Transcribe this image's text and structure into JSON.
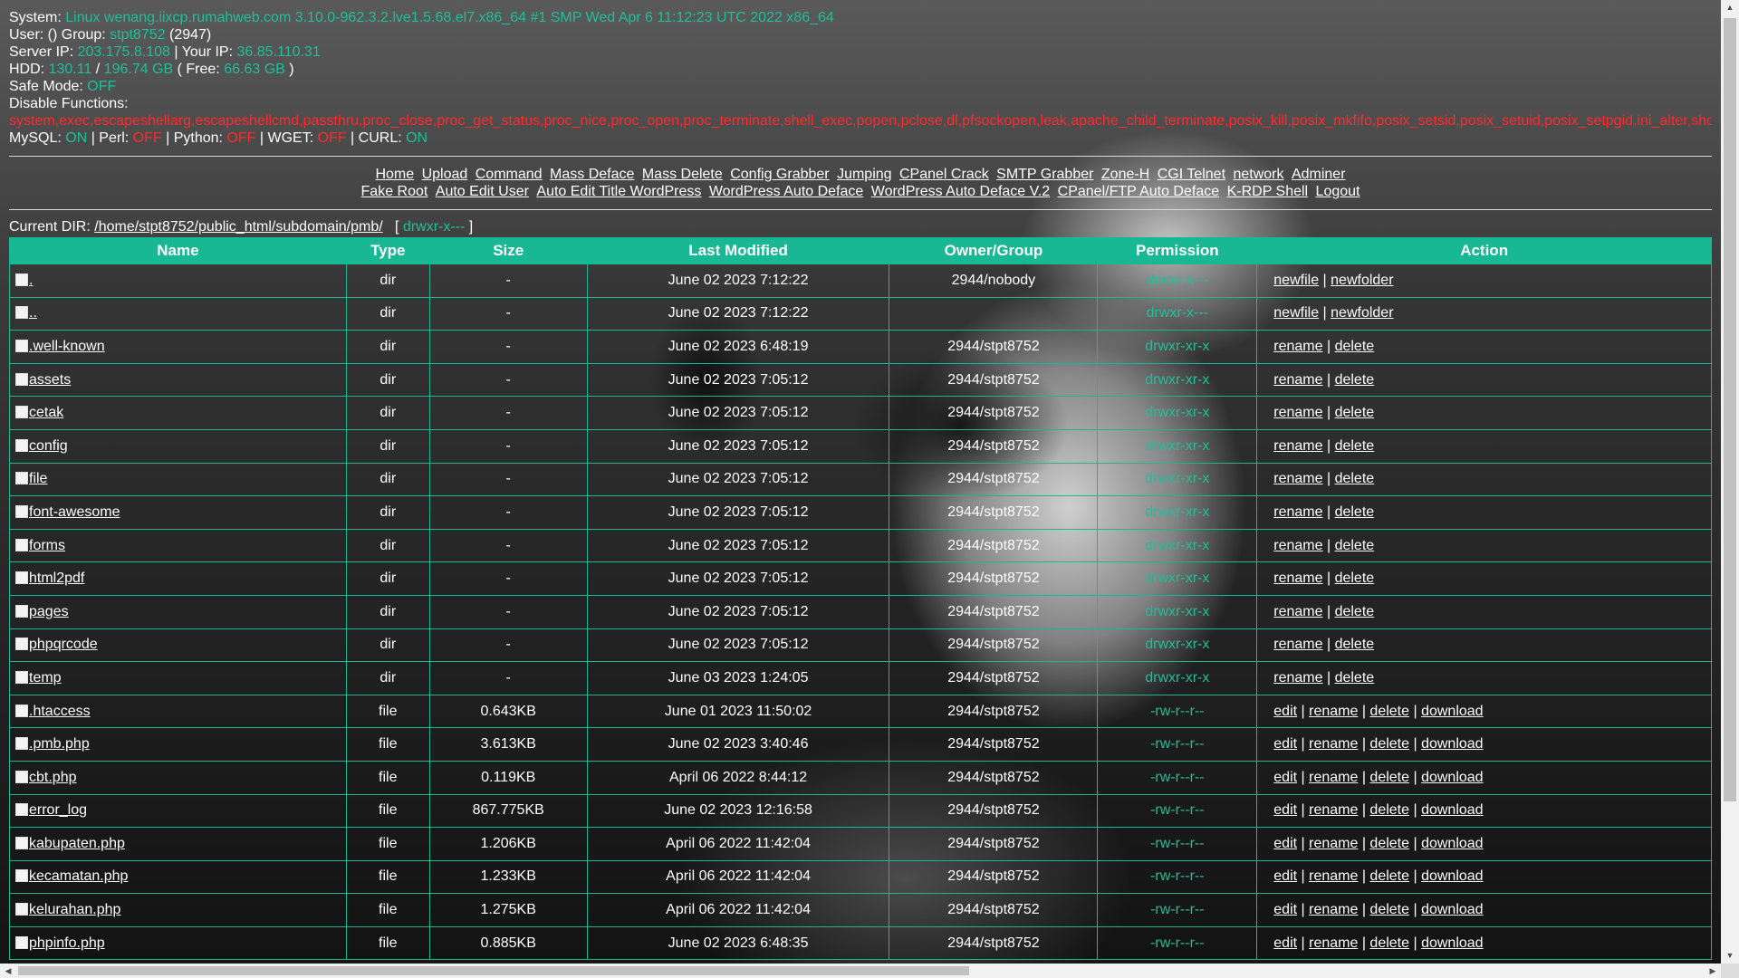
{
  "sysinfo": {
    "system_label": "System:",
    "system_value": "Linux wenang.iixcp.rumahweb.com 3.10.0-962.3.2.lve1.5.68.el7.x86_64 #1 SMP Wed Apr 6 11:12:23 UTC 2022 x86_64",
    "user_label": "User: () Group:",
    "group_value": "stpt8752",
    "group_id": "(2947)",
    "server_ip_label": "Server IP:",
    "server_ip": "203.175.8.108",
    "your_ip_label": "| Your IP:",
    "your_ip": "36.85.110.31",
    "hdd_label": "HDD:",
    "hdd_used": "130.11",
    "hdd_sep": "/",
    "hdd_total": "196.74 GB",
    "hdd_free_label": "( Free:",
    "hdd_free": "66.63 GB",
    "hdd_close": ")",
    "safe_mode_label": "Safe Mode:",
    "safe_mode": "OFF",
    "disable_label": "Disable Functions:",
    "disable_list": "system,exec,escapeshellarg,escapeshellcmd,passthru,proc_close,proc_get_status,proc_nice,proc_open,proc_terminate,shell_exec,popen,pclose,dl,pfsockopen,leak,apache_child_terminate,posix_kill,posix_mkfifo,posix_setsid,posix_setuid,posix_setpgid,ini_alter,show_source",
    "mysql_label": "MySQL:",
    "mysql": "ON",
    "perl_label": "| Perl:",
    "perl": "OFF",
    "python_label": "| Python:",
    "python": "OFF",
    "wget_label": "| WGET:",
    "wget": "OFF",
    "curl_label": "| CURL:",
    "curl": "ON"
  },
  "menu": {
    "row1": [
      "Home",
      "Upload",
      "Command",
      "Mass Deface",
      "Mass Delete",
      "Config Grabber",
      "Jumping",
      "CPanel Crack",
      "SMTP Grabber",
      "Zone-H",
      "CGI Telnet",
      "network",
      "Adminer"
    ],
    "row2": [
      "Fake Root",
      "Auto Edit User",
      "Auto Edit Title WordPress",
      "WordPress Auto Deface",
      "WordPress Auto Deface V.2",
      "CPanel/FTP Auto Deface",
      "K-RDP Shell",
      "Logout"
    ]
  },
  "current_dir": {
    "label": "Current DIR:",
    "path": "/home/stpt8752/public_html/subdomain/pmb/",
    "perm_open": "[",
    "perm": "drwxr-x---",
    "perm_close": "]"
  },
  "table": {
    "headers": [
      "Name",
      "Type",
      "Size",
      "Last Modified",
      "Owner/Group",
      "Permission",
      "Action"
    ],
    "rows": [
      {
        "name": ".",
        "type": "dir",
        "size": "-",
        "modified": "June 02 2023 7:12:22",
        "owner": "2944/nobody",
        "perm": "drwxr-x---",
        "actions": [
          "newfile",
          "newfolder"
        ]
      },
      {
        "name": "..",
        "type": "dir",
        "size": "-",
        "modified": "June 02 2023 7:12:22",
        "owner": "",
        "perm": "drwxr-x---",
        "actions": [
          "newfile",
          "newfolder"
        ]
      },
      {
        "name": ".well-known",
        "type": "dir",
        "size": "-",
        "modified": "June 02 2023 6:48:19",
        "owner": "2944/stpt8752",
        "perm": "drwxr-xr-x",
        "actions": [
          "rename",
          "delete"
        ]
      },
      {
        "name": "assets",
        "type": "dir",
        "size": "-",
        "modified": "June 02 2023 7:05:12",
        "owner": "2944/stpt8752",
        "perm": "drwxr-xr-x",
        "actions": [
          "rename",
          "delete"
        ]
      },
      {
        "name": "cetak",
        "type": "dir",
        "size": "-",
        "modified": "June 02 2023 7:05:12",
        "owner": "2944/stpt8752",
        "perm": "drwxr-xr-x",
        "actions": [
          "rename",
          "delete"
        ]
      },
      {
        "name": "config",
        "type": "dir",
        "size": "-",
        "modified": "June 02 2023 7:05:12",
        "owner": "2944/stpt8752",
        "perm": "drwxr-xr-x",
        "actions": [
          "rename",
          "delete"
        ]
      },
      {
        "name": "file",
        "type": "dir",
        "size": "-",
        "modified": "June 02 2023 7:05:12",
        "owner": "2944/stpt8752",
        "perm": "drwxr-xr-x",
        "actions": [
          "rename",
          "delete"
        ]
      },
      {
        "name": "font-awesome",
        "type": "dir",
        "size": "-",
        "modified": "June 02 2023 7:05:12",
        "owner": "2944/stpt8752",
        "perm": "drwxr-xr-x",
        "actions": [
          "rename",
          "delete"
        ]
      },
      {
        "name": "forms",
        "type": "dir",
        "size": "-",
        "modified": "June 02 2023 7:05:12",
        "owner": "2944/stpt8752",
        "perm": "drwxr-xr-x",
        "actions": [
          "rename",
          "delete"
        ]
      },
      {
        "name": "html2pdf",
        "type": "dir",
        "size": "-",
        "modified": "June 02 2023 7:05:12",
        "owner": "2944/stpt8752",
        "perm": "drwxr-xr-x",
        "actions": [
          "rename",
          "delete"
        ]
      },
      {
        "name": "pages",
        "type": "dir",
        "size": "-",
        "modified": "June 02 2023 7:05:12",
        "owner": "2944/stpt8752",
        "perm": "drwxr-xr-x",
        "actions": [
          "rename",
          "delete"
        ]
      },
      {
        "name": "phpqrcode",
        "type": "dir",
        "size": "-",
        "modified": "June 02 2023 7:05:12",
        "owner": "2944/stpt8752",
        "perm": "drwxr-xr-x",
        "actions": [
          "rename",
          "delete"
        ]
      },
      {
        "name": "temp",
        "type": "dir",
        "size": "-",
        "modified": "June 03 2023 1:24:05",
        "owner": "2944/stpt8752",
        "perm": "drwxr-xr-x",
        "actions": [
          "rename",
          "delete"
        ]
      },
      {
        "name": ".htaccess",
        "type": "file",
        "size": "0.643KB",
        "modified": "June 01 2023 11:50:02",
        "owner": "2944/stpt8752",
        "perm": "-rw-r--r--",
        "actions": [
          "edit",
          "rename",
          "delete",
          "download"
        ]
      },
      {
        "name": ".pmb.php",
        "type": "file",
        "size": "3.613KB",
        "modified": "June 02 2023 3:40:46",
        "owner": "2944/stpt8752",
        "perm": "-rw-r--r--",
        "actions": [
          "edit",
          "rename",
          "delete",
          "download"
        ]
      },
      {
        "name": "cbt.php",
        "type": "file",
        "size": "0.119KB",
        "modified": "April 06 2022 8:44:12",
        "owner": "2944/stpt8752",
        "perm": "-rw-r--r--",
        "actions": [
          "edit",
          "rename",
          "delete",
          "download"
        ]
      },
      {
        "name": "error_log",
        "type": "file",
        "size": "867.775KB",
        "modified": "June 02 2023 12:16:58",
        "owner": "2944/stpt8752",
        "perm": "-rw-r--r--",
        "actions": [
          "edit",
          "rename",
          "delete",
          "download"
        ]
      },
      {
        "name": "kabupaten.php",
        "type": "file",
        "size": "1.206KB",
        "modified": "April 06 2022 11:42:04",
        "owner": "2944/stpt8752",
        "perm": "-rw-r--r--",
        "actions": [
          "edit",
          "rename",
          "delete",
          "download"
        ]
      },
      {
        "name": "kecamatan.php",
        "type": "file",
        "size": "1.233KB",
        "modified": "April 06 2022 11:42:04",
        "owner": "2944/stpt8752",
        "perm": "-rw-r--r--",
        "actions": [
          "edit",
          "rename",
          "delete",
          "download"
        ]
      },
      {
        "name": "kelurahan.php",
        "type": "file",
        "size": "1.275KB",
        "modified": "April 06 2022 11:42:04",
        "owner": "2944/stpt8752",
        "perm": "-rw-r--r--",
        "actions": [
          "edit",
          "rename",
          "delete",
          "download"
        ]
      },
      {
        "name": "phpinfo.php",
        "type": "file",
        "size": "0.885KB",
        "modified": "June 02 2023 6:48:35",
        "owner": "2944/stpt8752",
        "perm": "-rw-r--r--",
        "actions": [
          "edit",
          "rename",
          "delete",
          "download"
        ]
      }
    ]
  },
  "colors": {
    "accent": "#18b894",
    "highlight": "#1fbf9a",
    "danger": "#ff2a2a"
  },
  "icons": {
    "file_row": "broken-image-icon"
  }
}
